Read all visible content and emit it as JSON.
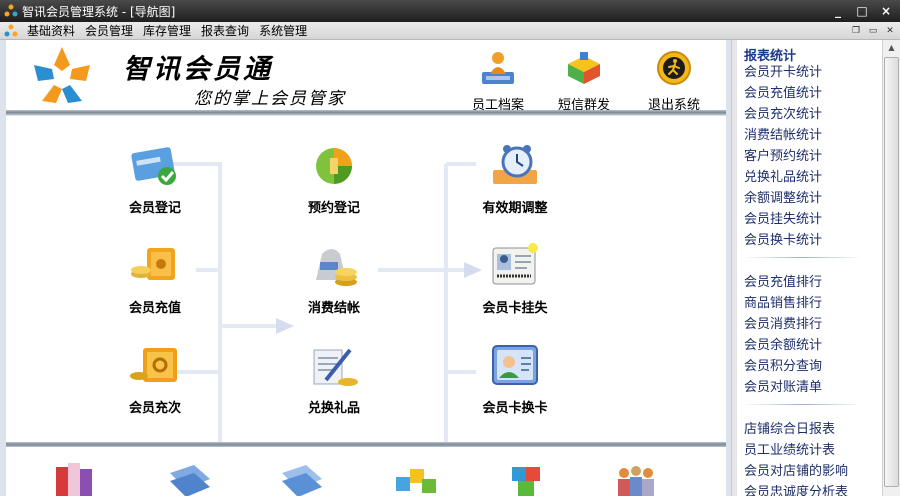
{
  "window": {
    "title": "智讯会员管理系统 - [导航图]",
    "controls": [
      "_",
      "□",
      "×"
    ]
  },
  "menu": [
    "基础资料",
    "会员管理",
    "库存管理",
    "报表查询",
    "系统管理"
  ],
  "header": {
    "brand_name": "智讯会员通",
    "slogan": "您的掌上会员管家",
    "buttons": [
      {
        "label": "员工档案",
        "icon": "employee-icon"
      },
      {
        "label": "短信群发",
        "icon": "sms-icon"
      },
      {
        "label": "退出系统",
        "icon": "exit-icon"
      }
    ]
  },
  "flow": {
    "col1": [
      "会员登记",
      "会员充值",
      "会员充次"
    ],
    "col2": [
      "预约登记",
      "消费结帐",
      "兑换礼品"
    ],
    "col3": [
      "有效期调整",
      "会员卡挂失",
      "会员卡换卡"
    ]
  },
  "right_panel": {
    "title": "报表统计",
    "group1": [
      "会员开卡统计",
      "会员充值统计",
      "会员充次统计",
      "消费结帐统计",
      "客户预约统计",
      "兑换礼品统计",
      "余额调整统计",
      "会员挂失统计",
      "会员换卡统计"
    ],
    "group2": [
      "会员充值排行",
      "商品销售排行",
      "会员消费排行",
      "会员余额统计",
      "会员积分查询",
      "会员对账清单"
    ],
    "group3": [
      "店铺综合日报表",
      "员工业绩统计表",
      "会员对店铺的影响",
      "会员忠诚度分析表"
    ]
  },
  "colors": {
    "accent": "#1b3a8c",
    "flow_line": "#e3e8f5",
    "flow_arrow": "#d5dcef"
  }
}
